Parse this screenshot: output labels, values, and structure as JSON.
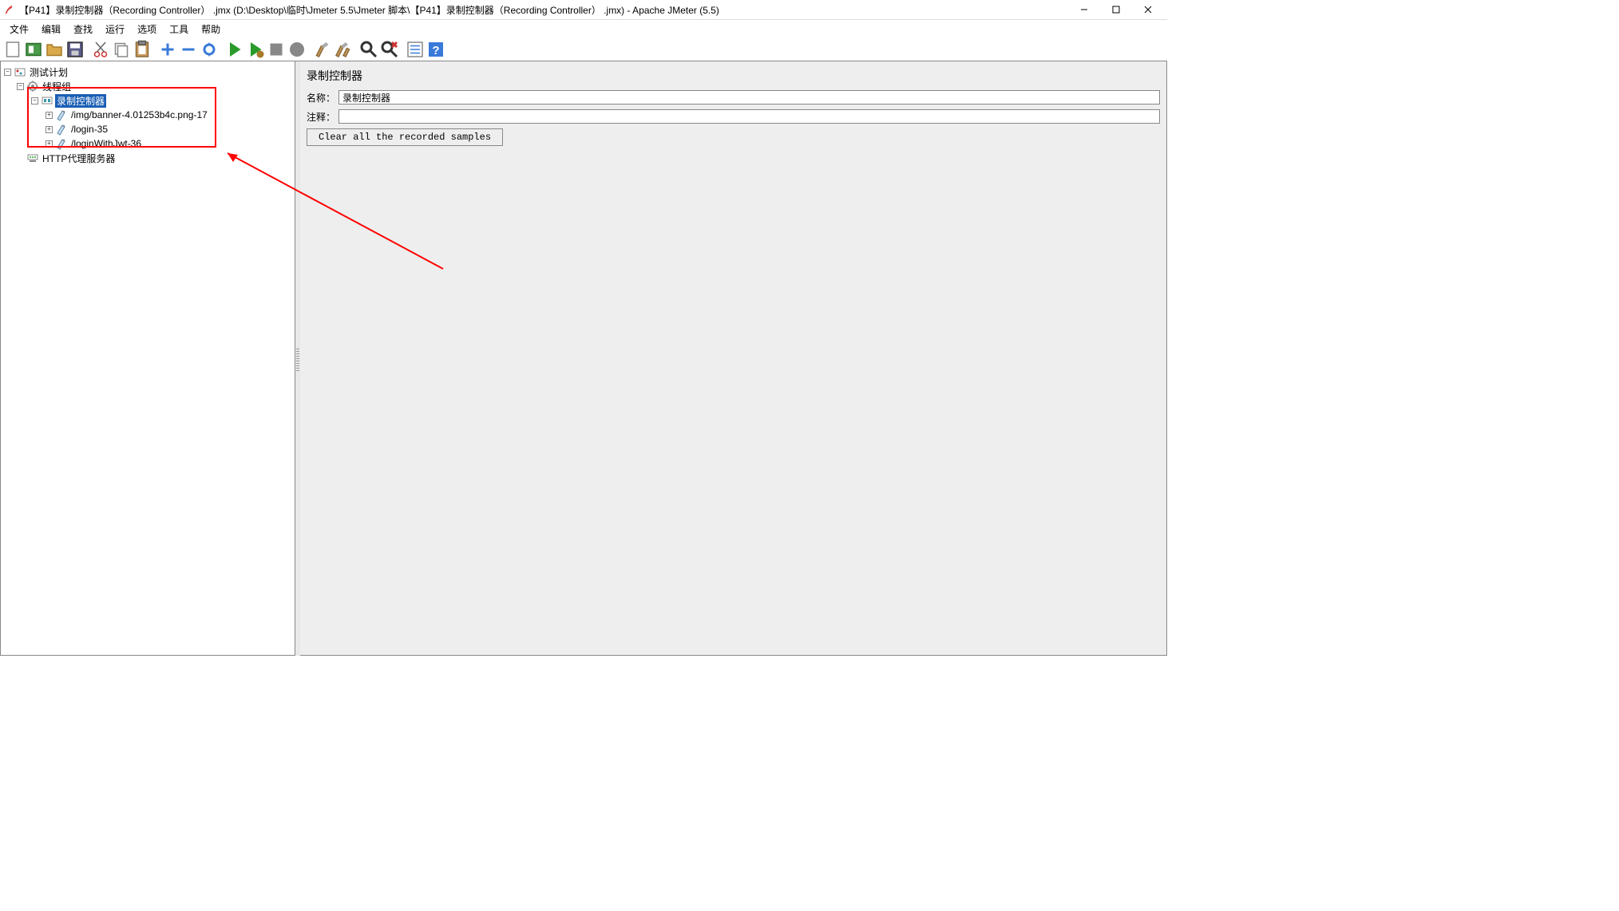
{
  "window": {
    "title": "【P41】录制控制器（Recording Controller） .jmx (D:\\Desktop\\临时\\Jmeter 5.5\\Jmeter 脚本\\【P41】录制控制器（Recording Controller） .jmx) - Apache JMeter (5.5)"
  },
  "menu": {
    "file": "文件",
    "edit": "编辑",
    "search": "查找",
    "run": "运行",
    "options": "选项",
    "tools": "工具",
    "help": "帮助"
  },
  "tree": {
    "root": "测试计划",
    "threadGroup": "线程组",
    "recordingController": "录制控制器",
    "sampler1": "/img/banner-4.01253b4c.png-17",
    "sampler2": "/login-35",
    "sampler3": "/loginWithJwt-36",
    "proxy": "HTTP代理服务器"
  },
  "main": {
    "heading": "录制控制器",
    "nameLabel": "名称：",
    "nameValue": "录制控制器",
    "commentLabel": "注释：",
    "commentValue": "",
    "clearBtn": "Clear all the recorded samples"
  }
}
